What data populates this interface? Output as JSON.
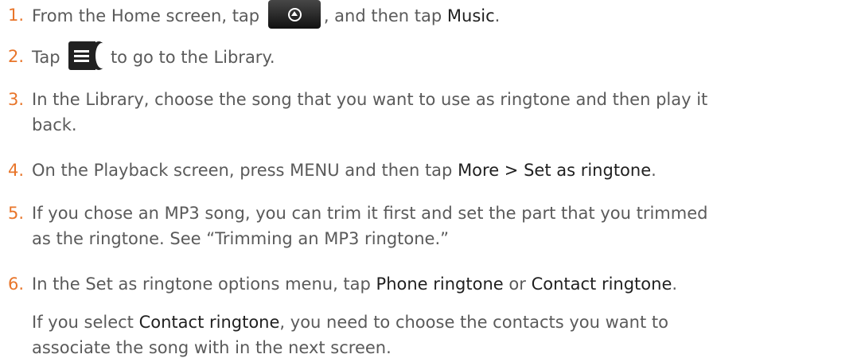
{
  "steps": [
    {
      "num": "1.",
      "p1": "From the Home screen, tap",
      "p2": ", and then tap",
      "hl1": "Music",
      "p3": "."
    },
    {
      "num": "2.",
      "p1": "Tap",
      "p2": "to go to the Library."
    },
    {
      "num": "3.",
      "text": "In the Library, choose the song that you want to use as ringtone and then play it",
      "text2": "back."
    },
    {
      "num": "4.",
      "p1": "On the Playback screen, press MENU and then tap",
      "hl1": "More > Set as ringtone",
      "p2": "."
    },
    {
      "num": "5.",
      "text": "If you chose an MP3 song, you can trim it first and set the part that you trimmed",
      "text2": "as the ringtone. See “Trimming an MP3 ringtone.”"
    },
    {
      "num": "6.",
      "p1": "In the Set as ringtone options menu, tap",
      "hl1": "Phone ringtone",
      "p2": "or",
      "hl2": "Contact ringtone",
      "p3": "."
    }
  ],
  "note": {
    "p1": "If you select",
    "hl1": "Contact ringtone",
    "p2": ", you need to choose the contacts you want to",
    "line2": "associate the song with in the next screen."
  },
  "icons": {
    "home_button": "home-button-icon",
    "library_button": "library-button-icon"
  }
}
